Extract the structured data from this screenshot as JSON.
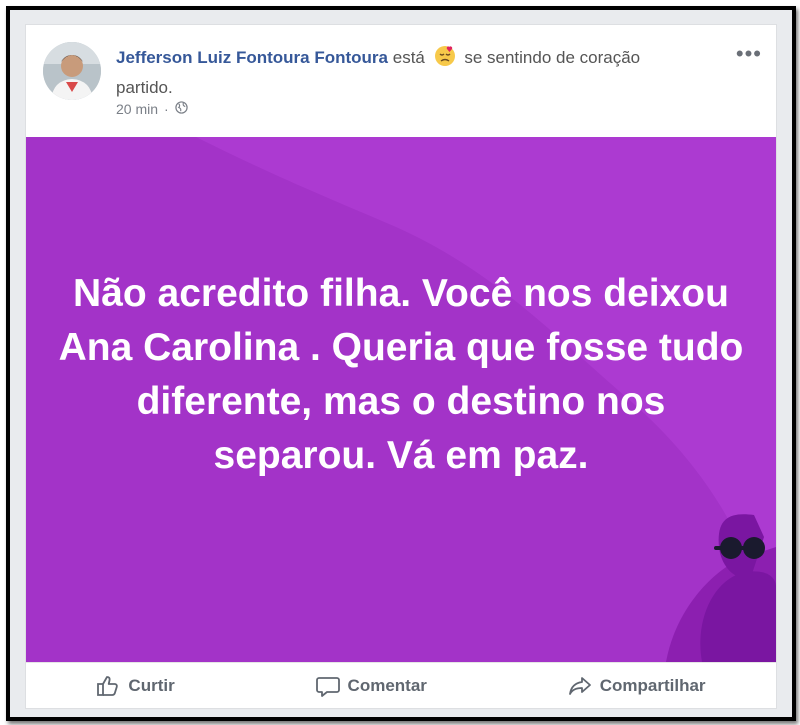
{
  "post": {
    "author": "Jefferson Luiz Fontoura Fontoura",
    "status_prefix": "está",
    "feeling_text": "se sentindo de coração partido.",
    "time": "20 min",
    "dot": "·",
    "text": "Não acredito filha. Você nos deixou Ana Carolina . Queria que fosse tudo diferente, mas o destino nos separou. Vá em paz.",
    "background_color": "#a333c8",
    "icons": {
      "privacy": "globe-icon",
      "feeling": "heartbroken-emoji-icon",
      "menu": "more-options-icon"
    }
  },
  "menu": {
    "more": "•••"
  },
  "actions": {
    "like": "Curtir",
    "comment": "Comentar",
    "share": "Compartilhar"
  }
}
